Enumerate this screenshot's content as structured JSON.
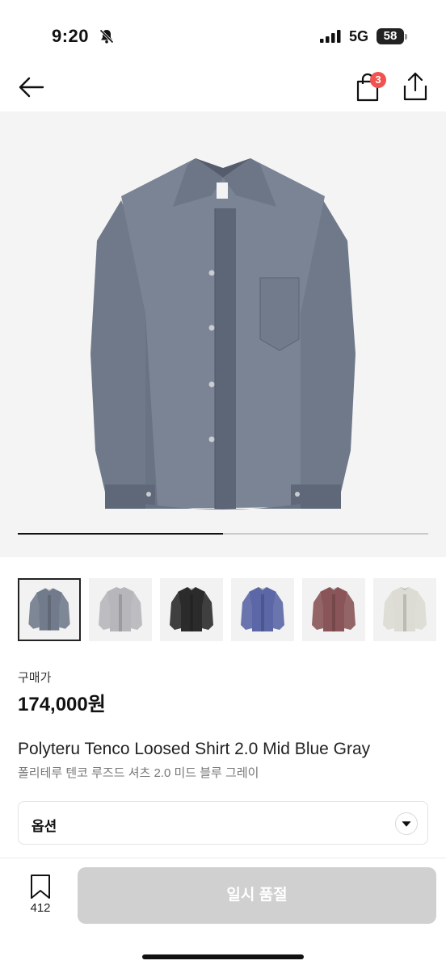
{
  "status_bar": {
    "time": "9:20",
    "network": "5G",
    "battery": "58",
    "icons": [
      "bell-slash-icon",
      "signal-icon",
      "battery-icon"
    ]
  },
  "header": {
    "back_icon": "arrow-left-icon",
    "cart_icon": "shopping-bag-icon",
    "cart_count": "3",
    "share_icon": "share-icon",
    "badge_color": "#f1524f"
  },
  "gallery": {
    "progress_fraction": 0.5,
    "thumbnails": [
      {
        "name": "mid-blue-gray",
        "color": "#717b8c",
        "active": true
      },
      {
        "name": "light-gray",
        "color": "#b7b6bb",
        "active": false
      },
      {
        "name": "black",
        "color": "#2b2b2b",
        "active": false
      },
      {
        "name": "blue",
        "color": "#5b67a6",
        "active": false
      },
      {
        "name": "burgundy",
        "color": "#8a5558",
        "active": false
      },
      {
        "name": "ivory",
        "color": "#dcdcd4",
        "active": false
      }
    ]
  },
  "price": {
    "label": "구매가",
    "value": "174,000원"
  },
  "product": {
    "name_en": "Polyteru Tenco Loosed Shirt 2.0 Mid Blue Gray",
    "name_ko": "폴리테루 텐코 루즈드 셔츠 2.0 미드 블루 그레이"
  },
  "option": {
    "label": "옵션",
    "chevron_icon": "chevron-down-icon"
  },
  "bottom_bar": {
    "wish_icon": "bookmark-icon",
    "wish_count": "412",
    "button_label": "일시 품절",
    "button_color": "#d0d0d0"
  }
}
